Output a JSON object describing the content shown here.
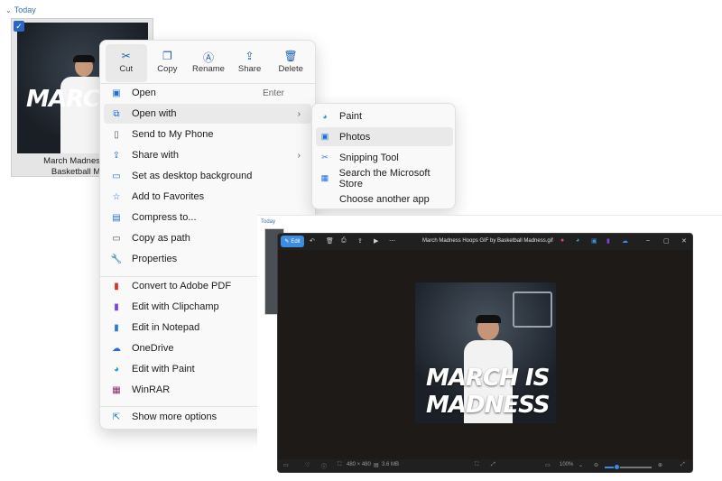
{
  "explorer": {
    "group_label": "Today",
    "file": {
      "name_line1": "March Madness Hoo",
      "name_line2": "Basketball Madn",
      "thumb_text": "MARCH"
    }
  },
  "context_menu": {
    "toolbar": [
      {
        "label": "Cut",
        "icon": "scissors-icon",
        "glyph": "✂"
      },
      {
        "label": "Copy",
        "icon": "copy-icon",
        "glyph": "❐"
      },
      {
        "label": "Rename",
        "icon": "rename-icon",
        "glyph": "Ⓐ"
      },
      {
        "label": "Share",
        "icon": "share-icon",
        "glyph": "⇪"
      },
      {
        "label": "Delete",
        "icon": "trash-icon",
        "glyph": "🗑"
      }
    ],
    "items": [
      {
        "label": "Open",
        "shortcut": "Enter",
        "icon": "photos-icon",
        "glyph": "▣",
        "color": "#1e6ed6"
      },
      {
        "label": "Open with",
        "arrow": "›",
        "icon": "open-with-icon",
        "glyph": "⧉",
        "color": "#1e6ed6"
      },
      {
        "label": "Send to My Phone",
        "icon": "phone-icon",
        "glyph": "▯",
        "color": "#555555"
      },
      {
        "label": "Share with",
        "arrow": "›",
        "icon": "share-with-icon",
        "glyph": "⇪",
        "color": "#1e6ed6"
      },
      {
        "label": "Set as desktop background",
        "icon": "desktop-icon",
        "glyph": "▭",
        "color": "#1e6ed6"
      },
      {
        "label": "Add to Favorites",
        "icon": "star-icon",
        "glyph": "☆",
        "color": "#1e6ed6"
      },
      {
        "label": "Compress to...",
        "arrow": "›",
        "icon": "compress-icon",
        "glyph": "▤",
        "color": "#1e6ed6"
      },
      {
        "label": "Copy as path",
        "icon": "path-icon",
        "glyph": "▭",
        "color": "#555555"
      },
      {
        "label": "Properties",
        "icon": "wrench-icon",
        "glyph": "🔧",
        "color": "#555555"
      },
      {
        "label": "Convert to Adobe PDF",
        "icon": "adobe-pdf-icon",
        "glyph": "▮",
        "color": "#d93025"
      },
      {
        "label": "Edit with Clipchamp",
        "icon": "clipchamp-icon",
        "glyph": "▮",
        "color": "#7b3fe4"
      },
      {
        "label": "Edit in Notepad",
        "icon": "notepad-icon",
        "glyph": "▮",
        "color": "#2b7bd6"
      },
      {
        "label": "OneDrive",
        "icon": "onedrive-icon",
        "glyph": "☁",
        "color": "#1e6ed6"
      },
      {
        "label": "Edit with Paint",
        "icon": "paint-icon",
        "glyph": "◕",
        "color": "#2b9ad6"
      },
      {
        "label": "WinRAR",
        "icon": "winrar-icon",
        "glyph": "▦",
        "color": "#8a2b6b"
      },
      {
        "label": "Show more options",
        "icon": "more-options-icon",
        "glyph": "⇱",
        "color": "#1e6ed6"
      }
    ]
  },
  "open_with_submenu": [
    {
      "label": "Paint",
      "icon": "paint-icon",
      "glyph": "◕",
      "color": "#2b9ad6"
    },
    {
      "label": "Photos",
      "icon": "photos-icon",
      "glyph": "▣",
      "color": "#1e6ed6"
    },
    {
      "label": "Snipping Tool",
      "icon": "snipping-tool-icon",
      "glyph": "✂",
      "color": "#2b7bd6"
    },
    {
      "label": "Search the Microsoft Store",
      "icon": "store-icon",
      "glyph": "▦",
      "color": "#1e6ed6"
    },
    {
      "label": "Choose another app",
      "icon": "",
      "glyph": "",
      "color": "#ffffff"
    }
  ],
  "explorer2": {
    "group_label": "Today"
  },
  "photos_app": {
    "edit_label": "Edit",
    "title": "March Madness Hoops GIF by Basketball Madness.gif",
    "image_line1": "MARCH IS",
    "image_line2": "MADNESS",
    "dimensions": "480 × 480",
    "size": "3.6 MB",
    "zoom": "100%",
    "zoom_level": 0.25,
    "accent": "#3c8de0"
  }
}
